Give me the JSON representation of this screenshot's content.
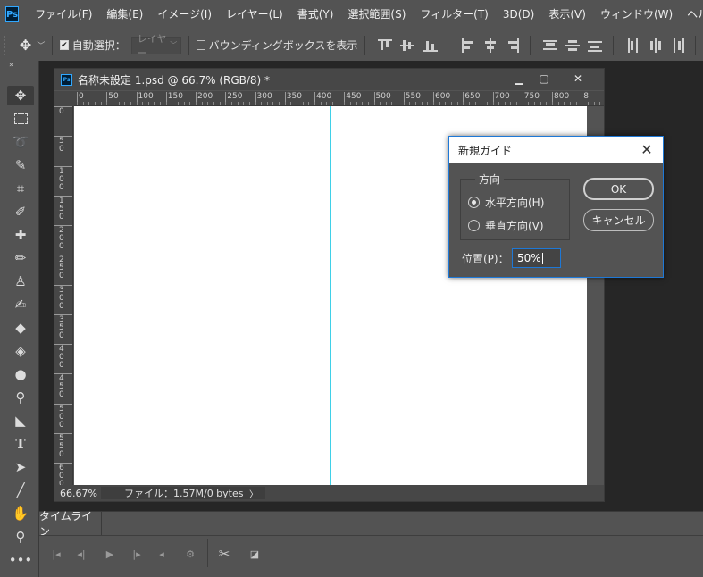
{
  "app": {
    "logo": "Ps"
  },
  "menu": [
    "ファイル(F)",
    "編集(E)",
    "イメージ(I)",
    "レイヤー(L)",
    "書式(Y)",
    "選択範囲(S)",
    "フィルター(T)",
    "3D(D)",
    "表示(V)",
    "ウィンドウ(W)",
    "ヘルプ(H)"
  ],
  "options": {
    "auto_select_label": "自動選択：",
    "auto_select_checked": true,
    "layer_select": "レイヤー",
    "bbox_label": "バウンディングボックスを表示",
    "bbox_checked": false
  },
  "document": {
    "title": "名称未設定 1.psd @ 66.7% (RGB/8) *",
    "zoom": "66.67%",
    "file_info": "ファイル：1.57M/0 bytes",
    "ruler_h": [
      "0",
      "50",
      "100",
      "150",
      "200",
      "250",
      "300",
      "350",
      "400",
      "450",
      "500",
      "550",
      "600",
      "650",
      "700",
      "750",
      "800",
      "8"
    ],
    "ruler_v": [
      "0",
      "50",
      "100",
      "150",
      "200",
      "250",
      "300",
      "350",
      "400",
      "450",
      "500",
      "550",
      "600"
    ],
    "guide_color": "#3fd0e8"
  },
  "timeline": {
    "tab_label": "タイムライン"
  },
  "dialog": {
    "title": "新規ガイド",
    "group_label": "方向",
    "horizontal_label": "水平方向(H)",
    "vertical_label": "垂直方向(V)",
    "selected": "horizontal",
    "ok_label": "OK",
    "cancel_label": "キャンセル",
    "position_label": "位置(P)：",
    "position_value": "50%"
  },
  "colors": {
    "accent": "#1e78d6",
    "panel": "#535353",
    "canvas": "#ffffff"
  }
}
